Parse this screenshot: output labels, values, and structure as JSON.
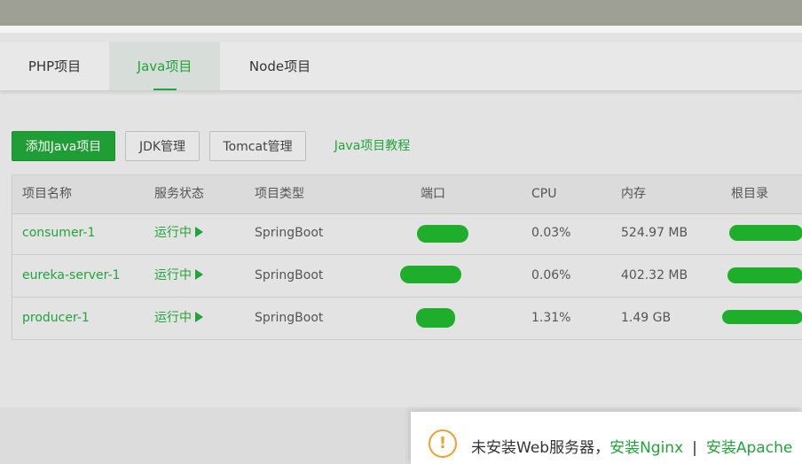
{
  "tabs": [
    {
      "label": "PHP项目"
    },
    {
      "label": "Java项目"
    },
    {
      "label": "Node项目"
    }
  ],
  "toolbar": {
    "add_label": "添加Java项目",
    "jdk_label": "JDK管理",
    "tomcat_label": "Tomcat管理",
    "tutorial_label": "Java项目教程"
  },
  "table": {
    "headers": [
      "项目名称",
      "服务状态",
      "项目类型",
      "端口",
      "CPU",
      "内存",
      "根目录"
    ],
    "rows": [
      {
        "name": "consumer-1",
        "status": "运行中",
        "type": "SpringBoot",
        "cpu": "0.03%",
        "memory": "524.97 MB"
      },
      {
        "name": "eureka-server-1",
        "status": "运行中",
        "type": "SpringBoot",
        "cpu": "0.06%",
        "memory": "402.32 MB"
      },
      {
        "name": "producer-1",
        "status": "运行中",
        "type": "SpringBoot",
        "cpu": "1.31%",
        "memory": "1.49 GB"
      }
    ]
  },
  "notice": {
    "text": "未安装Web服务器，",
    "link_nginx": "安装Nginx",
    "separator": "|",
    "link_apache": "安装Apache"
  },
  "colors": {
    "accent": "#20a53a",
    "warning": "#f0a02c"
  },
  "icons": {
    "status_running": "play-icon",
    "notice": "warning-circle-icon"
  }
}
